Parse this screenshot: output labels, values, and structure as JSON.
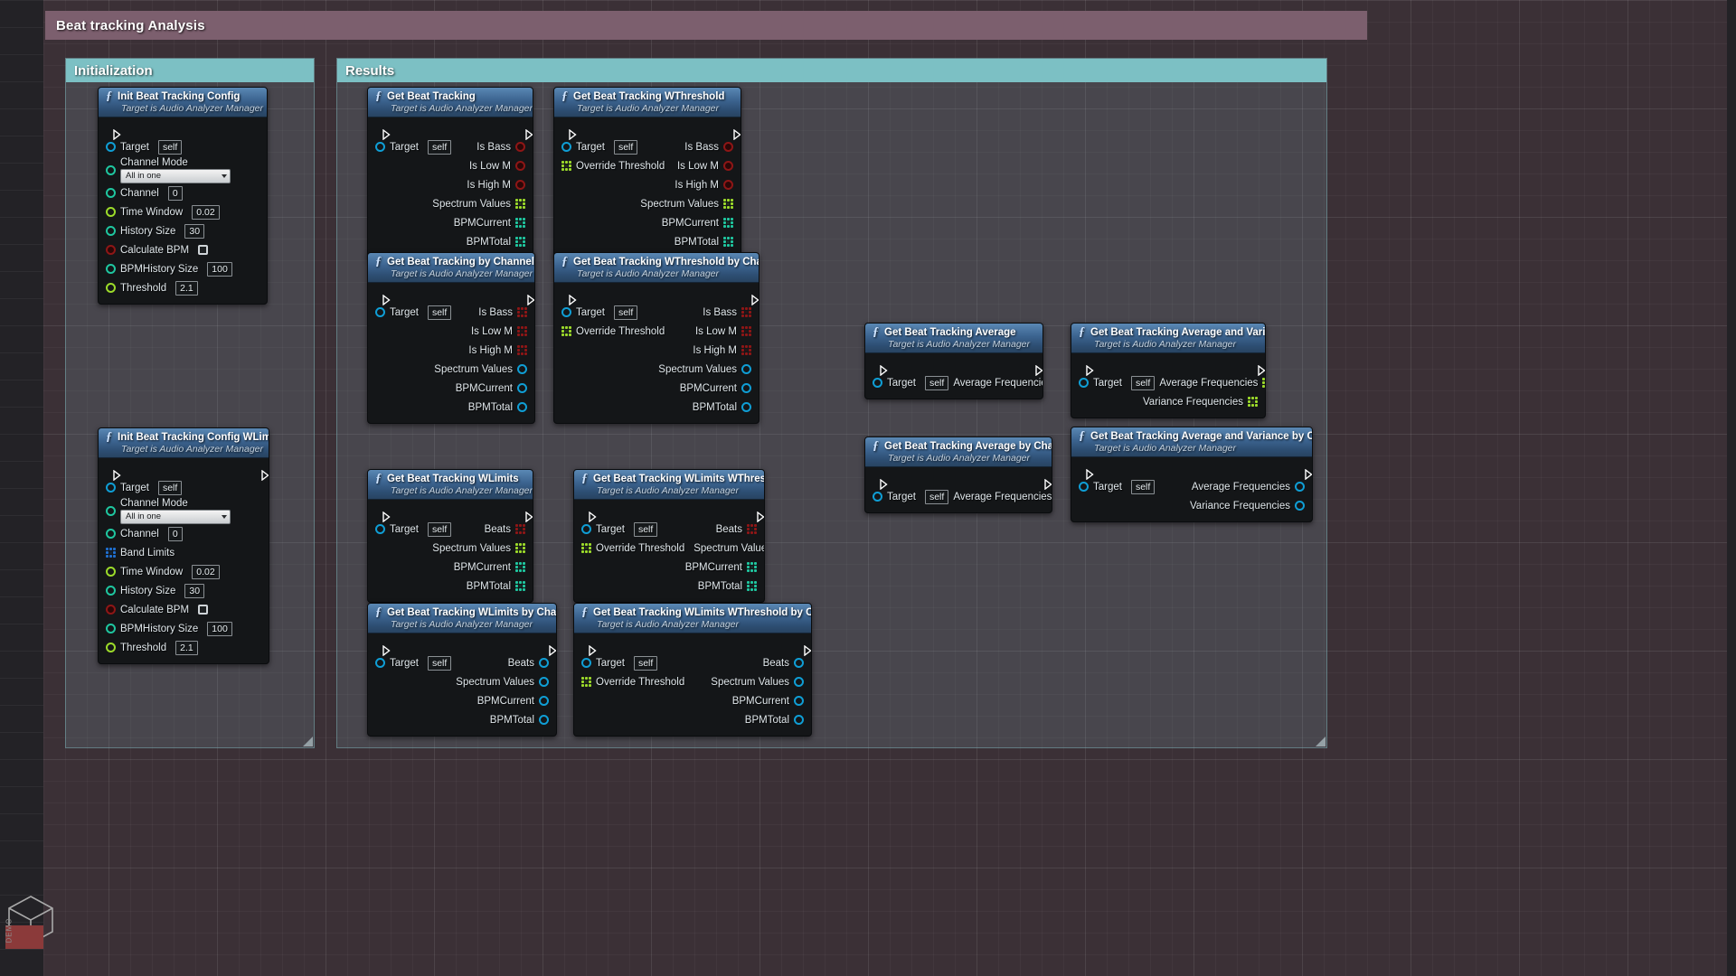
{
  "window": {
    "title": "Beat tracking Analysis"
  },
  "comments": [
    {
      "label": "Initialization"
    },
    {
      "label": "Results"
    }
  ],
  "common": {
    "subtitle": "Target is Audio Analyzer Manager",
    "target_label": "Target",
    "target_value": "self",
    "fx_icon": "function-icon",
    "exec_icon": "exec-pin-icon"
  },
  "labels": {
    "channel_mode": "Channel Mode",
    "channel_mode_value": "All in one",
    "channel": "Channel",
    "channel_value": "0",
    "band_limits": "Band Limits",
    "time_window": "Time Window",
    "time_window_value": "0.02",
    "history_size": "History Size",
    "history_size_value": "30",
    "calculate_bpm": "Calculate BPM",
    "bpm_history_size": "BPMHistory Size",
    "bpm_history_size_value": "100",
    "threshold": "Threshold",
    "threshold_value": "2.1",
    "override_threshold": "Override Threshold",
    "is_bass": "Is Bass",
    "is_low_m": "Is Low M",
    "is_high_m": "Is High M",
    "spectrum_values": "Spectrum Values",
    "bpm_current": "BPMCurrent",
    "bpm_total": "BPMTotal",
    "beats": "Beats",
    "average_frequencies": "Average Frequencies",
    "variance_frequencies": "Variance Frequencies"
  },
  "nodes": {
    "init_config": {
      "title": "Init Beat Tracking Config"
    },
    "init_config_wlimits": {
      "title": "Init Beat Tracking Config WLimits"
    },
    "get": {
      "title": "Get Beat Tracking"
    },
    "get_wthreshold": {
      "title": "Get Beat Tracking WThreshold"
    },
    "get_by_channel": {
      "title": "Get Beat Tracking by Channel"
    },
    "get_wthreshold_by_channel": {
      "title": "Get Beat Tracking WThreshold by Channel"
    },
    "get_wlimits": {
      "title": "Get Beat Tracking WLimits"
    },
    "get_wlimits_wthreshold": {
      "title": "Get Beat Tracking WLimits WThreshold"
    },
    "get_wlimits_by_channel": {
      "title": "Get Beat Tracking WLimits by Channel"
    },
    "get_wlimits_wthreshold_by_channel": {
      "title": "Get Beat Tracking WLimits WThreshold by Channel"
    },
    "get_average": {
      "title": "Get Beat Tracking Average"
    },
    "get_average_variance": {
      "title": "Get Beat Tracking Average and Variance"
    },
    "get_average_by_channel": {
      "title": "Get Beat Tracking Average by Channel"
    },
    "get_average_variance_by_channel": {
      "title": "Get Beat Tracking Average and Variance by Channel"
    }
  },
  "colors": {
    "comment_bar": "#7cc0c4",
    "title_bar": "#7c5f6e",
    "node_header": "#3c6490",
    "pin_object": "#0f9ed5",
    "pin_bool": "#8e1616",
    "pin_float": "#9cdb2a",
    "pin_int": "#1fc7a0",
    "pin_enum": "#1fc7a0",
    "pin_struct": "#1f6fd0",
    "exec": "#ffffff"
  },
  "watermark": {
    "text": "DEMO"
  }
}
